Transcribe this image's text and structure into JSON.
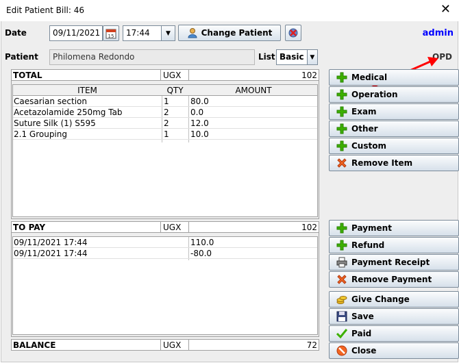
{
  "window": {
    "title": "Edit Patient Bill: 46",
    "close_glyph": "✕"
  },
  "header": {
    "date_label": "Date",
    "date_value": "09/11/2021",
    "time_value": "17:44",
    "change_patient_label": "Change Patient",
    "user": "admin",
    "patient_label": "Patient",
    "patient_value": "Philomena Redondo",
    "list_label": "List",
    "list_value": "Basic",
    "ward": "OPD"
  },
  "items_panel": {
    "total_label": "TOTAL",
    "currency": "UGX",
    "total_value": "102",
    "columns": [
      "ITEM",
      "QTY",
      "AMOUNT"
    ],
    "rows": [
      {
        "item": "Caesarian section",
        "qty": "1",
        "amount": "80.0"
      },
      {
        "item": "Acetazolamide 250mg Tab",
        "qty": "2",
        "amount": "0.0"
      },
      {
        "item": "Suture Silk (1) S595",
        "qty": "2",
        "amount": "12.0"
      },
      {
        "item": "2.1 Grouping",
        "qty": "1",
        "amount": "10.0"
      }
    ]
  },
  "payments_panel": {
    "topay_label": "TO PAY",
    "currency": "UGX",
    "topay_value": "102",
    "rows": [
      {
        "date": "09/11/2021 17:44",
        "amount": "110.0"
      },
      {
        "date": "09/11/2021 17:44",
        "amount": "-80.0"
      }
    ]
  },
  "balance": {
    "label": "BALANCE",
    "currency": "UGX",
    "value": "72"
  },
  "buttons": {
    "medical": "Medical",
    "operation": "Operation",
    "exam": "Exam",
    "other": "Other",
    "custom": "Custom",
    "remove_item": "Remove Item",
    "payment": "Payment",
    "refund": "Refund",
    "payment_receipt": "Payment Receipt",
    "remove_payment": "Remove Payment",
    "give_change": "Give Change",
    "save": "Save",
    "paid": "Paid",
    "close": "Close"
  },
  "colors": {
    "plus": "#3cb000",
    "remove": "#f26522",
    "admin": "#0000ff",
    "arrow": "#ff0000"
  }
}
